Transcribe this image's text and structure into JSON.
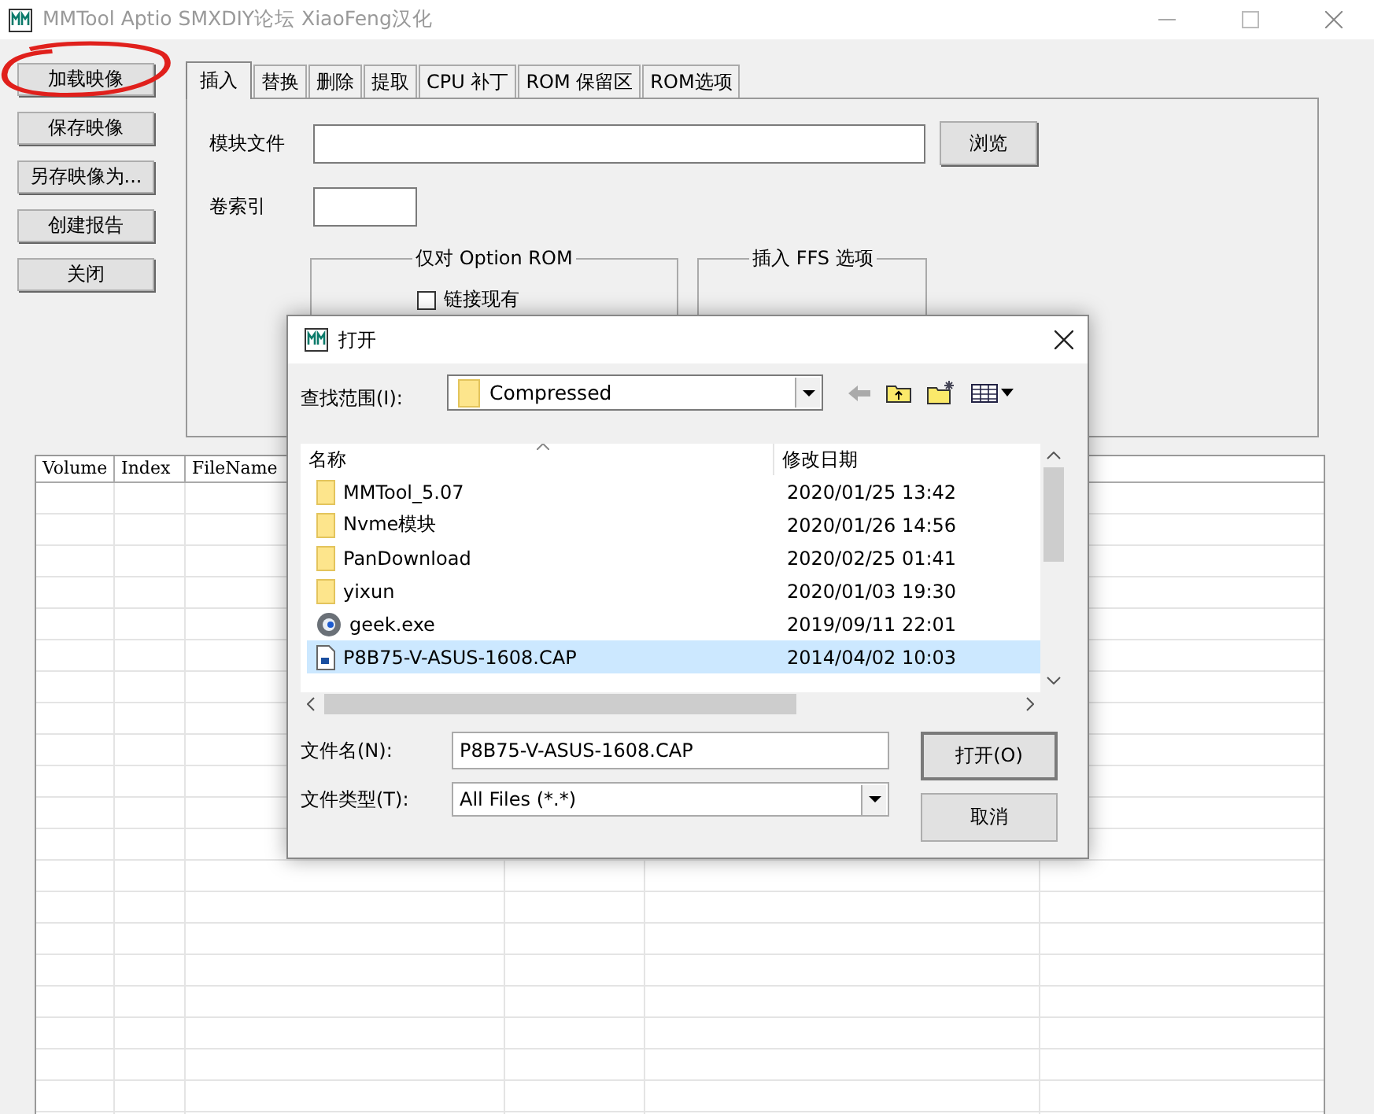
{
  "window": {
    "title": "MMTool Aptio SMXDIY论坛 XiaoFeng汉化"
  },
  "side_buttons": [
    "加载映像",
    "保存映像",
    "另存映像为...",
    "创建报告",
    "关闭"
  ],
  "tabs": [
    {
      "label": "插入",
      "selected": true
    },
    {
      "label": "替换",
      "selected": false
    },
    {
      "label": "删除",
      "selected": false
    },
    {
      "label": "提取",
      "selected": false
    },
    {
      "label": "CPU 补丁",
      "selected": false
    },
    {
      "label": "ROM 保留区",
      "selected": false
    },
    {
      "label": "ROM选项",
      "selected": false
    }
  ],
  "insert_panel": {
    "module_file_label": "模块文件",
    "browse_button": "浏览",
    "volume_index_label": "卷索引",
    "groups": [
      {
        "title": "仅对 Option ROM",
        "checkbox": {
          "label": "链接现有",
          "checked": false
        }
      },
      {
        "title": "插入 FFS 选项"
      }
    ]
  },
  "table": {
    "columns": [
      "Volume",
      "Index",
      "FileName"
    ]
  },
  "dialog": {
    "title": "打开",
    "look_in_label": "查找范围(I):",
    "look_in_value": "Compressed",
    "columns": [
      "名称",
      "修改日期"
    ],
    "files": [
      {
        "name": "MMTool_5.07",
        "date": "2020/01/25 13:42",
        "kind": "folder",
        "selected": false
      },
      {
        "name": "Nvme模块",
        "date": "2020/01/26 14:56",
        "kind": "folder",
        "selected": false
      },
      {
        "name": "PanDownload",
        "date": "2020/02/25 01:41",
        "kind": "folder",
        "selected": false
      },
      {
        "name": "yixun",
        "date": "2020/01/03 19:30",
        "kind": "folder",
        "selected": false
      },
      {
        "name": "geek.exe",
        "date": "2019/09/11 22:01",
        "kind": "exe",
        "selected": false
      },
      {
        "name": "P8B75-V-ASUS-1608.CAP",
        "date": "2014/04/02 10:03",
        "kind": "file",
        "selected": true
      }
    ],
    "file_name_label": "文件名(N):",
    "file_name_value": "P8B75-V-ASUS-1608.CAP",
    "file_type_label": "文件类型(T):",
    "file_type_value": "All Files (*.*)",
    "buttons": [
      "打开(O)",
      "取消"
    ]
  }
}
